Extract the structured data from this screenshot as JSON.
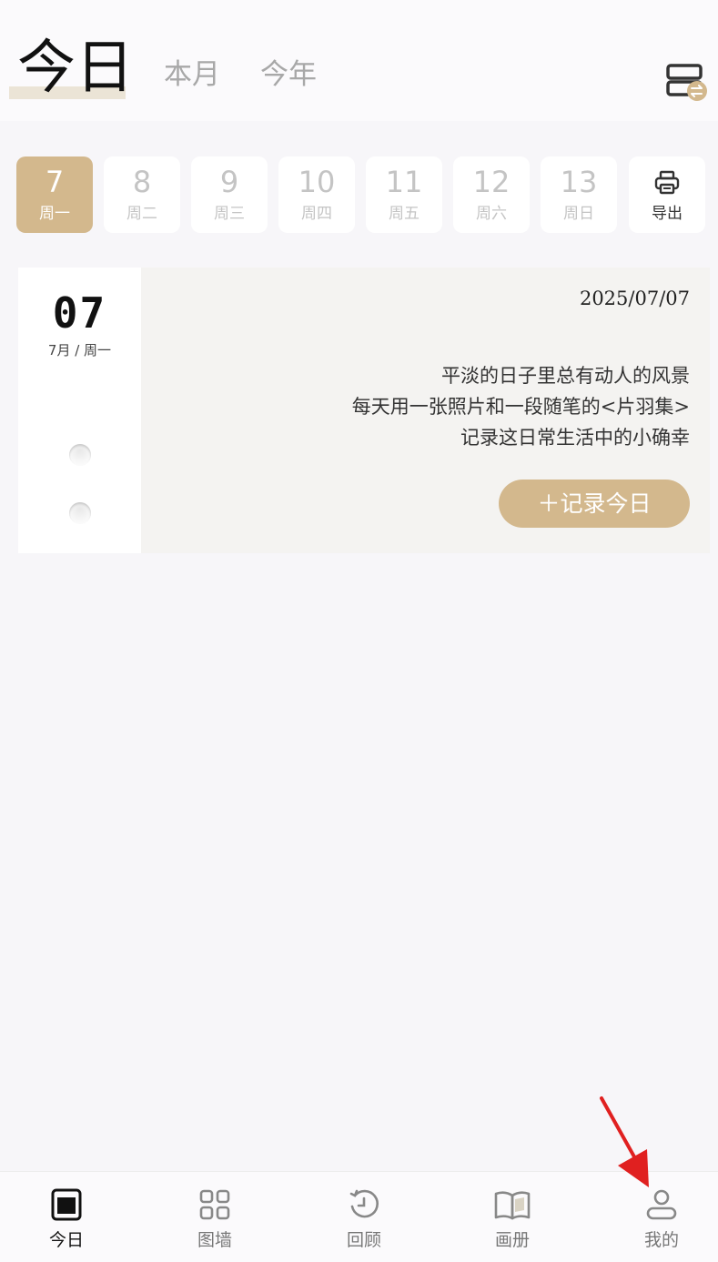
{
  "header": {
    "tabs": [
      "今日",
      "本月",
      "今年"
    ],
    "active_tab": "今日",
    "switch_icon": "layout-switch-icon"
  },
  "week": {
    "days": [
      {
        "num": "7",
        "weekday": "周一",
        "active": true
      },
      {
        "num": "8",
        "weekday": "周二",
        "active": false
      },
      {
        "num": "9",
        "weekday": "周三",
        "active": false
      },
      {
        "num": "10",
        "weekday": "周四",
        "active": false
      },
      {
        "num": "11",
        "weekday": "周五",
        "active": false
      },
      {
        "num": "12",
        "weekday": "周六",
        "active": false
      },
      {
        "num": "13",
        "weekday": "周日",
        "active": false
      }
    ],
    "export_label": "导出",
    "export_icon": "printer-icon"
  },
  "card": {
    "day": "07",
    "month_weekday": "7月 / 周一",
    "date": "2025/07/07",
    "quote": [
      "平淡的日子里总有动人的风景",
      "每天用一张照片和一段随笔的<片羽集>",
      "记录这日常生活中的小确幸"
    ],
    "record_button": "＋记录今日"
  },
  "bottom_nav": {
    "items": [
      {
        "label": "今日",
        "icon": "today-icon",
        "active": true
      },
      {
        "label": "图墙",
        "icon": "grid-icon",
        "active": false
      },
      {
        "label": "回顾",
        "icon": "history-icon",
        "active": false
      },
      {
        "label": "画册",
        "icon": "book-icon",
        "active": false
      },
      {
        "label": "我的",
        "icon": "user-icon",
        "active": false
      }
    ]
  },
  "colors": {
    "accent": "#d3b88d",
    "background": "#f7f6f9",
    "annotation_arrow": "#e02020"
  }
}
